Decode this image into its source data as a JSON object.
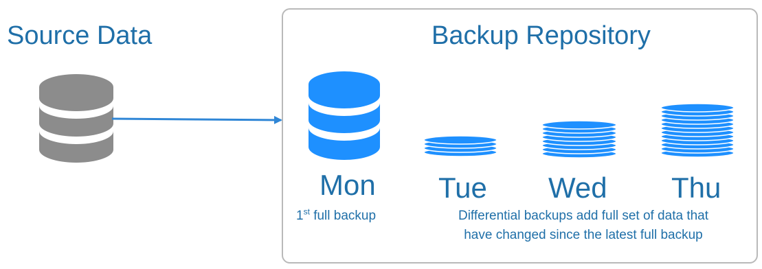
{
  "source": {
    "title": "Source Data"
  },
  "repository": {
    "title": "Backup Repository",
    "days": [
      {
        "label": "Mon"
      },
      {
        "label": "Tue"
      },
      {
        "label": "Wed"
      },
      {
        "label": "Thu"
      }
    ],
    "full_backup_note": {
      "prefix": "1",
      "superscript": "st",
      "text": " full backup"
    },
    "differential_note": {
      "line1": "Differential backups add full set of data that",
      "line2": "have changed since the latest full backup"
    }
  },
  "colors": {
    "text_blue": "#1f6fa8",
    "db_gray": "#8c8c8c",
    "db_blue": "#1e90ff",
    "arrow": "#2f86d6",
    "box_border": "#b9b9b9"
  },
  "icons": {
    "source": "database-icon",
    "monday": "database-icon",
    "tuesday": "disk-stack-icon",
    "wednesday": "disk-stack-icon",
    "thursday": "disk-stack-icon"
  }
}
